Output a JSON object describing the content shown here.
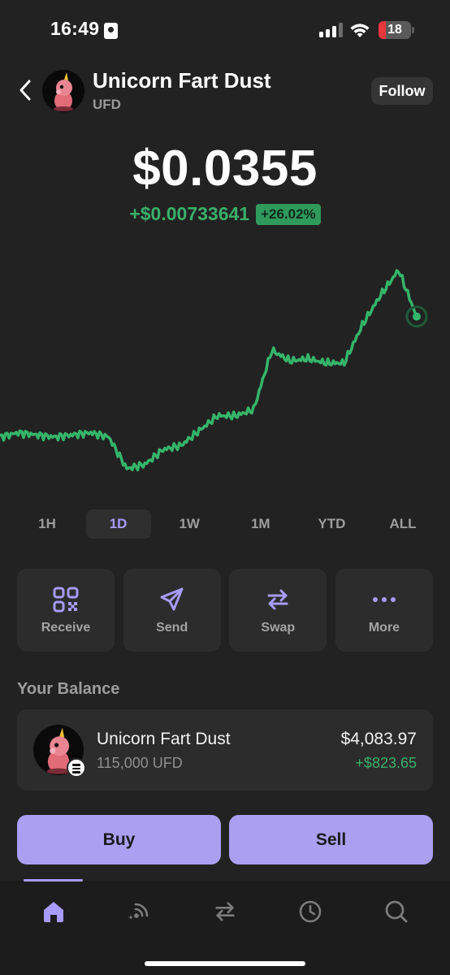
{
  "status_bar": {
    "time": "16:49",
    "battery": "18"
  },
  "header": {
    "token_name": "Unicorn Fart Dust",
    "token_symbol": "UFD",
    "follow_label": "Follow",
    "back_icon": "chevron-left-icon"
  },
  "price": {
    "value": "$0.0355",
    "change_abs": "+$0.00733641",
    "change_pct": "+26.02%"
  },
  "chart_data": {
    "type": "line",
    "color": "#35b56a",
    "y_relative_range": [
      0,
      1
    ],
    "x": [
      0,
      5,
      10,
      15,
      20,
      25,
      30,
      35,
      40,
      45,
      50,
      55,
      60,
      65,
      70,
      75,
      80,
      85,
      90,
      95,
      100
    ],
    "y": [
      0.17,
      0.19,
      0.18,
      0.17,
      0.18,
      0.19,
      0.17,
      0.02,
      0.04,
      0.11,
      0.13,
      0.2,
      0.27,
      0.27,
      0.3,
      0.58,
      0.53,
      0.54,
      0.52,
      0.52,
      0.7,
      0.84,
      0.96,
      0.74
    ]
  },
  "ranges": [
    "1H",
    "1D",
    "1W",
    "1M",
    "YTD",
    "ALL"
  ],
  "active_range": "1D",
  "actions": [
    {
      "label": "Receive",
      "icon": "qr-code-icon"
    },
    {
      "label": "Send",
      "icon": "send-icon"
    },
    {
      "label": "Swap",
      "icon": "swap-icon"
    },
    {
      "label": "More",
      "icon": "more-icon"
    }
  ],
  "balance": {
    "title": "Your Balance",
    "name": "Unicorn Fart Dust",
    "quantity": "115,000 UFD",
    "value": "$4,083.97",
    "change": "+$823.65"
  },
  "buttons": {
    "buy": "Buy",
    "sell": "Sell"
  },
  "nav": [
    "home-icon",
    "activity-feed-icon",
    "swap-icon",
    "history-icon",
    "search-icon"
  ],
  "colors": {
    "accent": "#ab9ff2",
    "positive": "#39b06a",
    "background": "#222222",
    "card": "#2c2c2c"
  }
}
